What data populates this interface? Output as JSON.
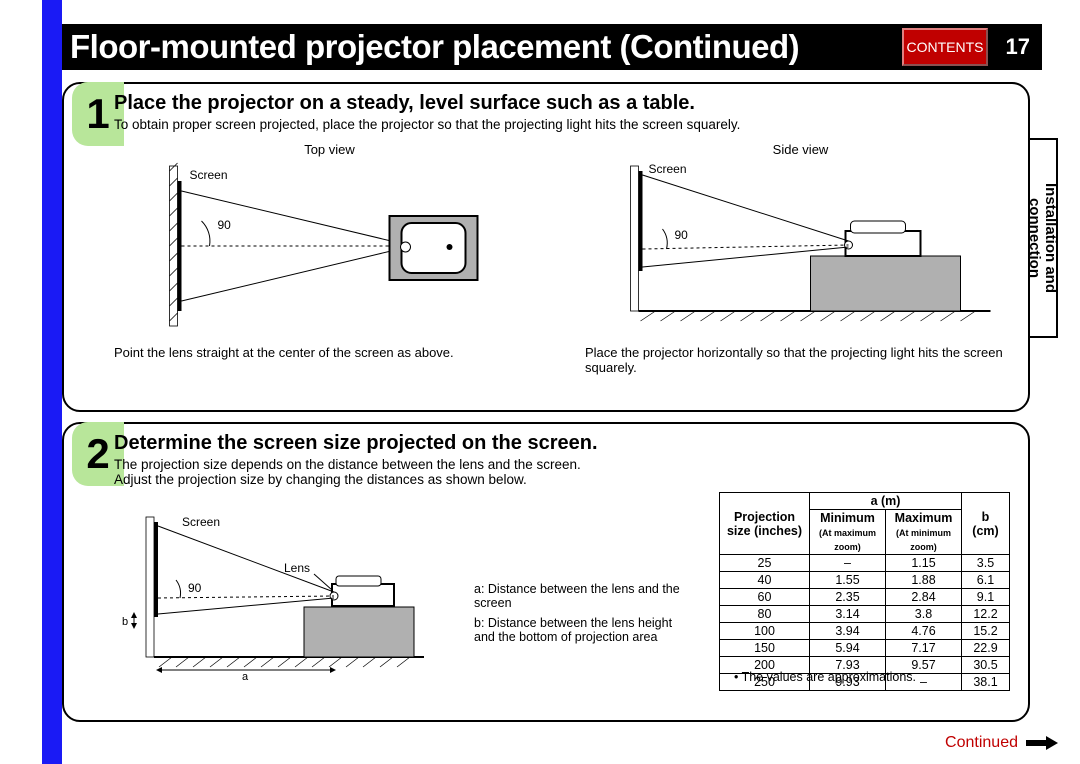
{
  "header": {
    "title": "Floor-mounted projector placement (Continued)",
    "contents_label": "CONTENTS",
    "page_number": "17"
  },
  "side_tab": "Installation and\nconnection",
  "step1": {
    "num": "1",
    "heading": "Place the projector on a steady, level surface such as a table.",
    "sub": "To obtain proper screen projected, place the projector so that the projecting light hits the screen squarely.",
    "topview": {
      "title": "Top view",
      "screen_label": "Screen",
      "angle": "90",
      "caption": "Point the lens straight at the center of the screen as above."
    },
    "sideview": {
      "title": "Side view",
      "screen_label": "Screen",
      "angle": "90",
      "caption": "Place the projector horizontally so that the projecting light hits the screen squarely."
    }
  },
  "step2": {
    "num": "2",
    "heading": "Determine the screen size projected on the screen.",
    "sub1": "The projection size depends on the distance between the lens and the screen.",
    "sub2": "Adjust the projection size by changing the distances as shown below.",
    "diagram": {
      "screen_label": "Screen",
      "lens_label": "Lens",
      "angle": "90",
      "a_label": "a",
      "b_label": "b"
    },
    "legend": {
      "a": "a: Distance between the lens and the screen",
      "b": "b: Distance between the lens height and the bottom of projection area"
    },
    "table_header": {
      "projsize": "Projection size (inches)",
      "a_m": "a (m)",
      "min": "Minimum",
      "max": "Maximum",
      "min_note": "(At maximum zoom)",
      "max_note": "(At minimum zoom)",
      "b_cm": "b (cm)"
    },
    "table_note": "• The values are approximations."
  },
  "continued": "Continued",
  "chart_data": {
    "type": "table",
    "columns": [
      "Projection size (inches)",
      "Minimum a (m) at maximum zoom",
      "Maximum a (m) at minimum zoom",
      "b (cm)"
    ],
    "rows": [
      {
        "size": 25,
        "min": null,
        "max": 1.15,
        "b": 3.5
      },
      {
        "size": 40,
        "min": 1.55,
        "max": 1.88,
        "b": 6.1
      },
      {
        "size": 60,
        "min": 2.35,
        "max": 2.84,
        "b": 9.1
      },
      {
        "size": 80,
        "min": 3.14,
        "max": 3.8,
        "b": 12.2
      },
      {
        "size": 100,
        "min": 3.94,
        "max": 4.76,
        "b": 15.2
      },
      {
        "size": 150,
        "min": 5.94,
        "max": 7.17,
        "b": 22.9
      },
      {
        "size": 200,
        "min": 7.93,
        "max": 9.57,
        "b": 30.5
      },
      {
        "size": 250,
        "min": 9.93,
        "max": null,
        "b": 38.1
      }
    ]
  }
}
